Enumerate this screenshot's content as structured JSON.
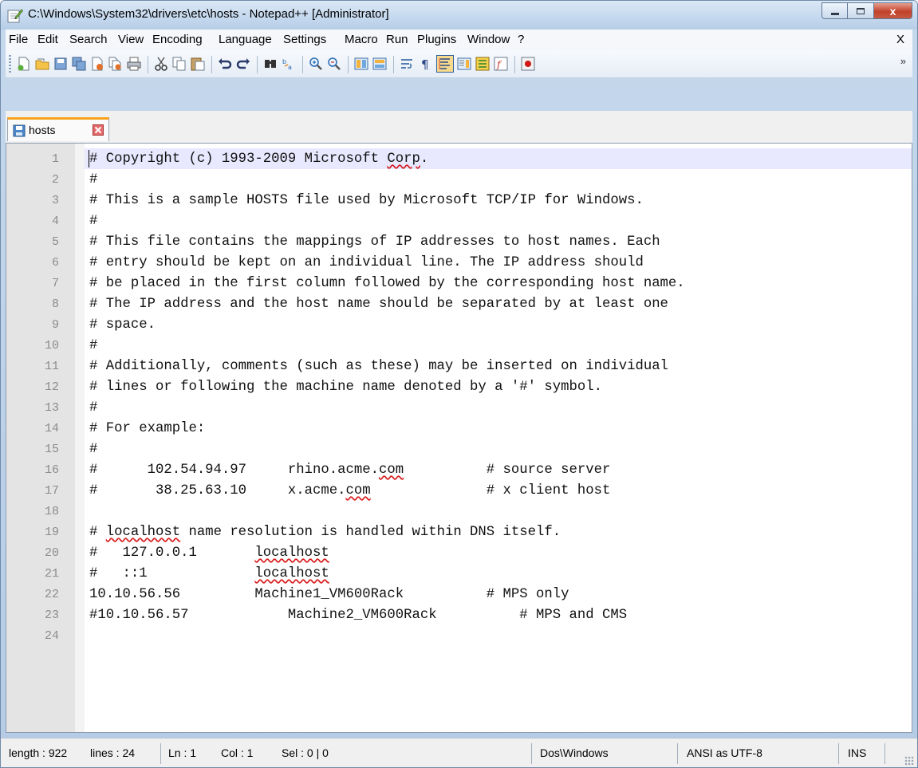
{
  "window": {
    "title": "C:\\Windows\\System32\\drivers\\etc\\hosts - Notepad++ [Administrator]",
    "controls": {
      "close_glyph": "x"
    }
  },
  "menu": {
    "items": [
      "File",
      "Edit",
      "Search",
      "View",
      "Encoding",
      "Language",
      "Settings",
      "Macro",
      "Run",
      "Plugins",
      "Window",
      "?"
    ],
    "close_doc": "X"
  },
  "toolbar": {
    "icons": [
      "new-file-icon",
      "open-file-icon",
      "save-icon",
      "save-all-icon",
      "close-icon",
      "close-all-icon",
      "print-icon",
      "cut-icon",
      "copy-icon",
      "paste-icon",
      "undo-icon",
      "redo-icon",
      "find-icon",
      "replace-icon",
      "zoom-in-icon",
      "zoom-out-icon",
      "sync-vertical-icon",
      "sync-horizontal-icon",
      "word-wrap-icon",
      "show-all-chars-icon",
      "indent-guide-icon",
      "doc-map-icon",
      "function-list-icon",
      "folder-workspace-icon",
      "record-macro-icon"
    ],
    "overflow": "»"
  },
  "tabs": [
    {
      "label": "hosts",
      "active": true
    }
  ],
  "editor": {
    "lines": [
      "# Copyright (c) 1993-2009 Microsoft Corp.",
      "#",
      "# This is a sample HOSTS file used by Microsoft TCP/IP for Windows.",
      "#",
      "# This file contains the mappings of IP addresses to host names. Each",
      "# entry should be kept on an individual line. The IP address should",
      "# be placed in the first column followed by the corresponding host name.",
      "# The IP address and the host name should be separated by at least one",
      "# space.",
      "#",
      "# Additionally, comments (such as these) may be inserted on individual",
      "# lines or following the machine name denoted by a '#' symbol.",
      "#",
      "# For example:",
      "#",
      "#      102.54.94.97     rhino.acme.com          # source server",
      "#       38.25.63.10     x.acme.com              # x client host",
      "",
      "# localhost name resolution is handled within DNS itself.",
      "#   127.0.0.1       localhost",
      "#   ::1             localhost",
      "10.10.56.56         Machine1_VM600Rack          # MPS only",
      "#10.10.56.57            Machine2_VM600Rack          # MPS and CMS",
      ""
    ],
    "current_line": 1
  },
  "status": {
    "length": "length : 922",
    "lines": "lines : 24",
    "ln": "Ln : 1",
    "col": "Col : 1",
    "sel": "Sel : 0 | 0",
    "eol": "Dos\\Windows",
    "encoding": "ANSI as UTF-8",
    "mode": "INS"
  }
}
